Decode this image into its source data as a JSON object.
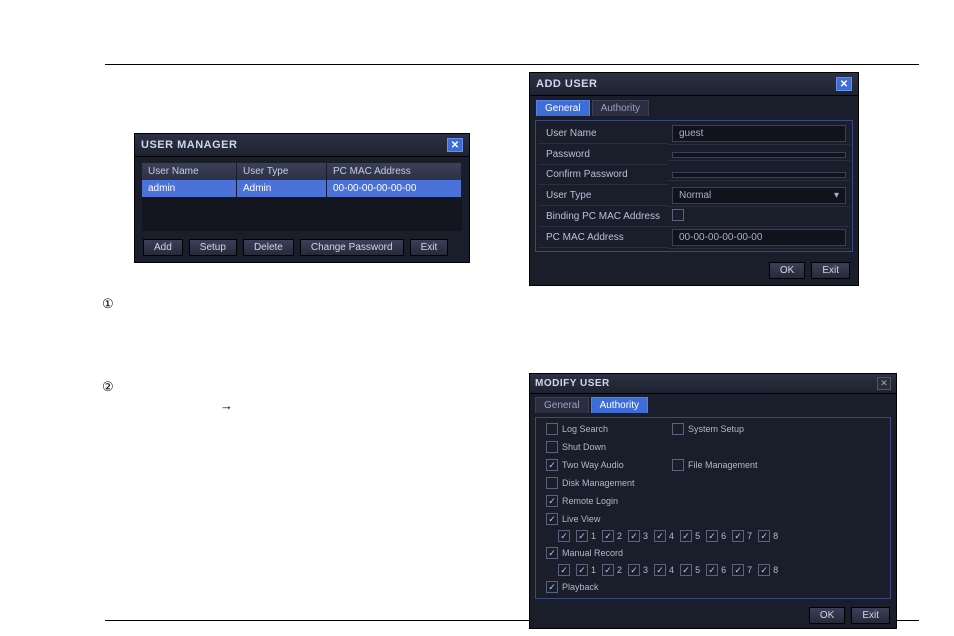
{
  "user_manager": {
    "title": "USER MANAGER",
    "columns": {
      "user_name": "User Name",
      "user_type": "User Type",
      "mac": "PC MAC Address"
    },
    "rows": [
      {
        "user_name": "admin",
        "user_type": "Admin",
        "mac": "00-00-00-00-00-00"
      }
    ],
    "buttons": {
      "add": "Add",
      "setup": "Setup",
      "delete": "Delete",
      "change_pw": "Change Password",
      "exit": "Exit"
    }
  },
  "add_user": {
    "title": "ADD USER",
    "tabs": {
      "general": "General",
      "authority": "Authority"
    },
    "fields": {
      "user_name_lbl": "User Name",
      "user_name_val": "guest",
      "password_lbl": "Password",
      "confirm_lbl": "Confirm Password",
      "user_type_lbl": "User Type",
      "user_type_val": "Normal",
      "binding_lbl": "Binding PC MAC Address",
      "mac_lbl": "PC MAC Address",
      "mac_val": "00-00-00-00-00-00"
    },
    "buttons": {
      "ok": "OK",
      "exit": "Exit"
    }
  },
  "modify_user": {
    "title": "MODIFY USER",
    "tabs": {
      "general": "General",
      "authority": "Authority"
    },
    "perms": {
      "log_search": "Log Search",
      "system_setup": "System Setup",
      "shut_down": "Shut Down",
      "two_way": "Two Way Audio",
      "file_mgmt": "File Management",
      "disk_mgmt": "Disk Management",
      "remote_login": "Remote Login",
      "live_view": "Live View",
      "manual_record": "Manual Record",
      "playback": "Playback"
    },
    "channels": [
      "1",
      "2",
      "3",
      "4",
      "5",
      "6",
      "7",
      "8"
    ],
    "buttons": {
      "ok": "OK",
      "exit": "Exit"
    }
  },
  "marks": {
    "one": "①",
    "two": "②",
    "arrow": "→"
  }
}
